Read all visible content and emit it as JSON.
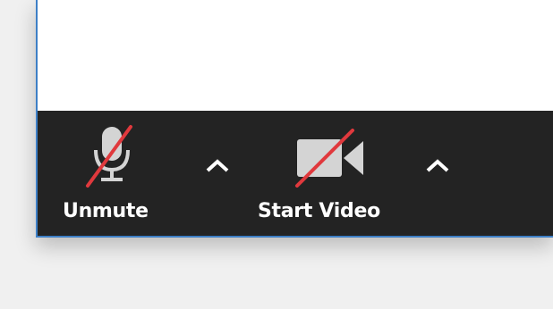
{
  "toolbar": {
    "audio": {
      "label": "Unmute",
      "icon": "microphone-muted-icon",
      "options_icon": "chevron-up-icon"
    },
    "video": {
      "label": "Start Video",
      "icon": "video-camera-off-icon",
      "options_icon": "chevron-up-icon"
    }
  },
  "colors": {
    "toolbar_background": "#232323",
    "icon_gray": "#d4d4d4",
    "mute_slash_red": "#e0393d",
    "window_border": "#3d7fc6"
  }
}
